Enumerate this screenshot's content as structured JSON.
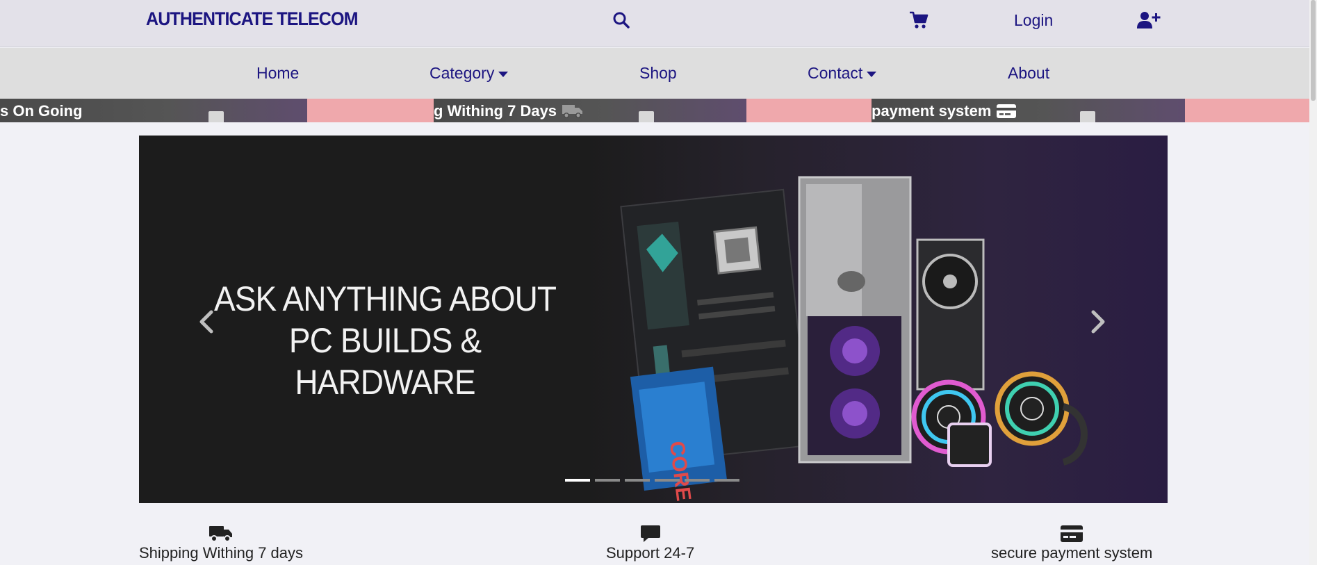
{
  "header": {
    "logo": "AUTHENTICATE TELECOM",
    "search_icon": "search-icon",
    "cart_icon": "cart-icon",
    "login_label": "Login",
    "signup_icon": "user-plus-icon"
  },
  "nav": {
    "items": [
      {
        "label": "Home",
        "dropdown": false
      },
      {
        "label": "Category",
        "dropdown": true
      },
      {
        "label": "Shop",
        "dropdown": false
      },
      {
        "label": "Contact",
        "dropdown": true
      },
      {
        "label": "About",
        "dropdown": false
      }
    ]
  },
  "ticker": {
    "items": [
      {
        "text": "s On Going",
        "icon": ""
      },
      {
        "text": "g Withing 7 Days",
        "icon": "truck-icon"
      },
      {
        "text": "payment system",
        "icon": "credit-card-icon"
      }
    ]
  },
  "carousel": {
    "headline_line1": "ASK ANYTHING ABOUT",
    "headline_line2": "PC BUILDS & HARDWARE",
    "slide_count": 6,
    "active_slide": 1
  },
  "features": [
    {
      "label": "Shipping Withing 7 days",
      "icon": "truck-icon"
    },
    {
      "label": "Support 24-7",
      "icon": "chat-icon"
    },
    {
      "label": "secure payment system",
      "icon": "credit-card-icon"
    }
  ],
  "colors": {
    "brand": "#1c1581",
    "topbar_bg": "#e3e1e9",
    "navbar_bg": "#dedede",
    "ticker_pink": "#efa8ac",
    "page_bg": "#f1f1f6"
  }
}
